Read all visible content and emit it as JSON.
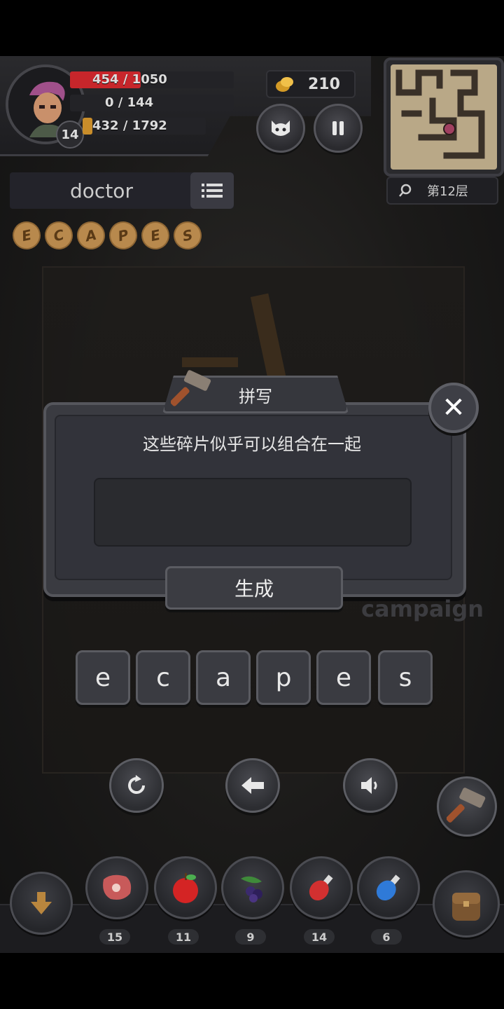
{
  "hud": {
    "level": "14",
    "hp_text": "454 / 1050",
    "hp_fraction": 0.432,
    "mana_text": "0 / 144",
    "xp_text": "432 / 1792",
    "coins": "210",
    "floor": "第12层",
    "colors": {
      "hp": "#c7262b",
      "xp": "#c98d2a",
      "accent": "#b8894d"
    }
  },
  "word_panel": {
    "word": "doctor",
    "fragments": [
      "E",
      "C",
      "A",
      "P",
      "E",
      "S"
    ]
  },
  "dialog": {
    "title": "拼写",
    "prompt": "这些碎片似乎可以组合在一起",
    "answer_value": "",
    "generate_label": "生成",
    "close_symbol": "✕"
  },
  "background_text": "campaign",
  "letters": [
    "e",
    "c",
    "a",
    "p",
    "e",
    "s"
  ],
  "controls": {
    "reset_icon": "refresh-icon",
    "back_icon": "backspace-arrow-icon",
    "sound_icon": "speaker-icon"
  },
  "inventory": [
    {
      "name": "meat",
      "count": "15"
    },
    {
      "name": "apple",
      "count": "11"
    },
    {
      "name": "berries",
      "count": "9"
    },
    {
      "name": "red-potion",
      "count": "14"
    },
    {
      "name": "blue-potion",
      "count": "6"
    }
  ]
}
